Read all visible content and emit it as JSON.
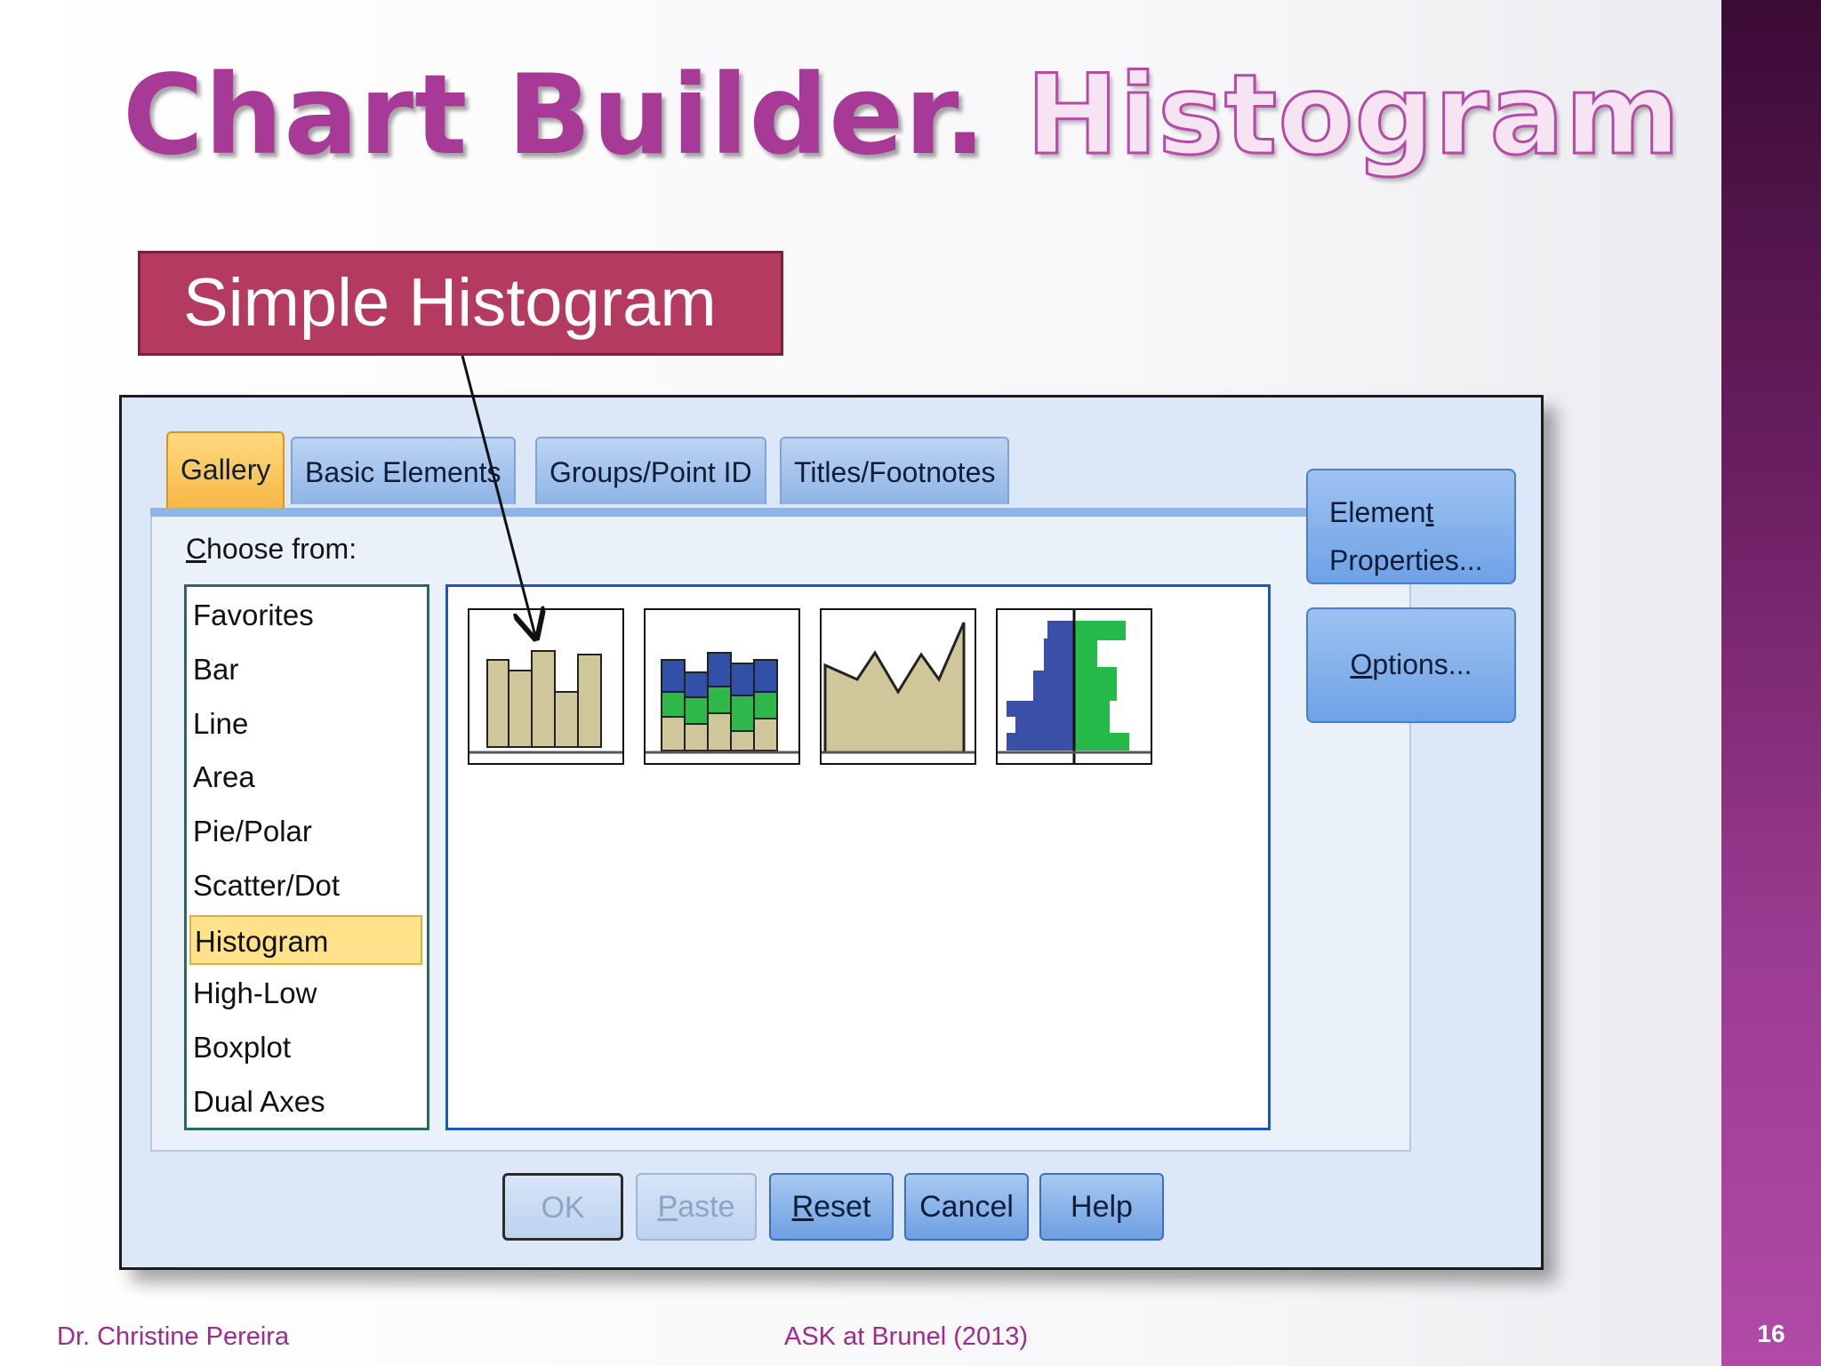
{
  "slide": {
    "title_part1": "Chart Builder.",
    "title_part2": "Histogram",
    "callout": "Simple Histogram",
    "page_number": "16",
    "footer_left": "Dr. Christine Pereira",
    "footer_center": "ASK at Brunel (2013)"
  },
  "tabs": [
    {
      "label": "Gallery",
      "active": true
    },
    {
      "label": "Basic Elements",
      "active": false
    },
    {
      "label": "Groups/Point ID",
      "active": false
    },
    {
      "label": "Titles/Footnotes",
      "active": false
    }
  ],
  "choose_from": {
    "u": "C",
    "rest": "hoose from:"
  },
  "chart_types": [
    "Favorites",
    "Bar",
    "Line",
    "Area",
    "Pie/Polar",
    "Scatter/Dot",
    "Histogram",
    "High-Low",
    "Boxplot",
    "Dual Axes"
  ],
  "selected_type": "Histogram",
  "gallery": [
    {
      "name": "simple-histogram-thumb"
    },
    {
      "name": "stacked-histogram-thumb"
    },
    {
      "name": "frequency-polygon-thumb"
    },
    {
      "name": "population-pyramid-thumb"
    }
  ],
  "side_buttons": {
    "element_properties": {
      "line1_pre": "Elemen",
      "line1_u": "t",
      "line2": "Properties..."
    },
    "options": {
      "u": "O",
      "rest": "ptions..."
    }
  },
  "bottom_buttons": {
    "ok": "OK",
    "paste": {
      "u": "P",
      "rest": "aste"
    },
    "reset": {
      "u": "R",
      "rest": "eset"
    },
    "cancel": "Cancel",
    "help": "Help"
  },
  "colors": {
    "accent": "#a63a96",
    "callout": "#b43a5f",
    "tab_active": "#f5b540",
    "dialog_bg": "#dce8f7"
  }
}
